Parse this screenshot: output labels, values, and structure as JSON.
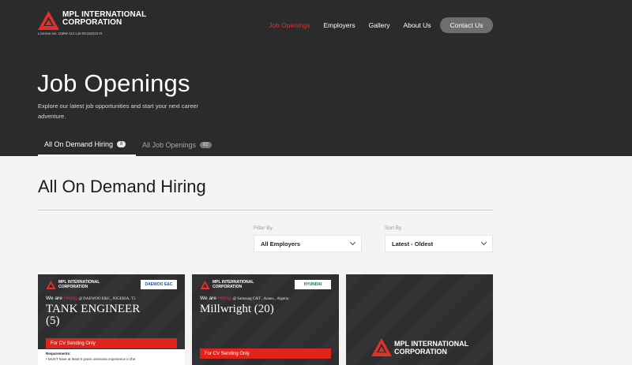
{
  "header": {
    "logo_line1": "MPL INTERNATIONAL",
    "logo_line2": "CORPORATION",
    "license": "License No. DMW-112-LB-06152023-R",
    "nav": [
      "Job Openings",
      "Employers",
      "Gallery",
      "About Us"
    ],
    "contact": "Contact Us",
    "accent_color": "#e0312b"
  },
  "hero": {
    "title": "Job Openings",
    "subtitle": "Explore our latest job opportunities and start your next career adventure."
  },
  "tabs": [
    {
      "label": "All On Demand Hiring",
      "count": "8"
    },
    {
      "label": "All Job Openings",
      "count": "82"
    }
  ],
  "main": {
    "title": "All On Demand Hiring",
    "filter_label": "Filter By",
    "filter_value": "All Employers",
    "sort_label": "Sort By",
    "sort_value": "Latest - Oldest"
  },
  "cards": [
    {
      "logo_line1": "MPL INTERNATIONAL",
      "logo_line2": "CORPORATION",
      "partner": "DAEWOO E&C",
      "hiring_prefix": "We are",
      "hiring_word": "Hiring",
      "location": "@ DAEWOO E&C , NIGERIA, T3",
      "title_line1": "TANK ENGINEER",
      "title_line2": "(5)",
      "cv": "For CV Sending Only",
      "req_heading": "Requirements:",
      "req_item": "• MUST have at least 5 years overseas experience in the"
    },
    {
      "logo_line1": "MPL INTERNATIONAL",
      "logo_line2": "CORPORATION",
      "partner": "HYUNDAI",
      "hiring_prefix": "We are",
      "hiring_word": "Hiring",
      "location": "@ Samsung C&T , Annex , Algeria",
      "title_line1": "Millwright (20)",
      "cv": "For CV Sending Only"
    },
    {
      "logo_line1": "MPL INTERNATIONAL",
      "logo_line2": "CORPORATION"
    }
  ]
}
